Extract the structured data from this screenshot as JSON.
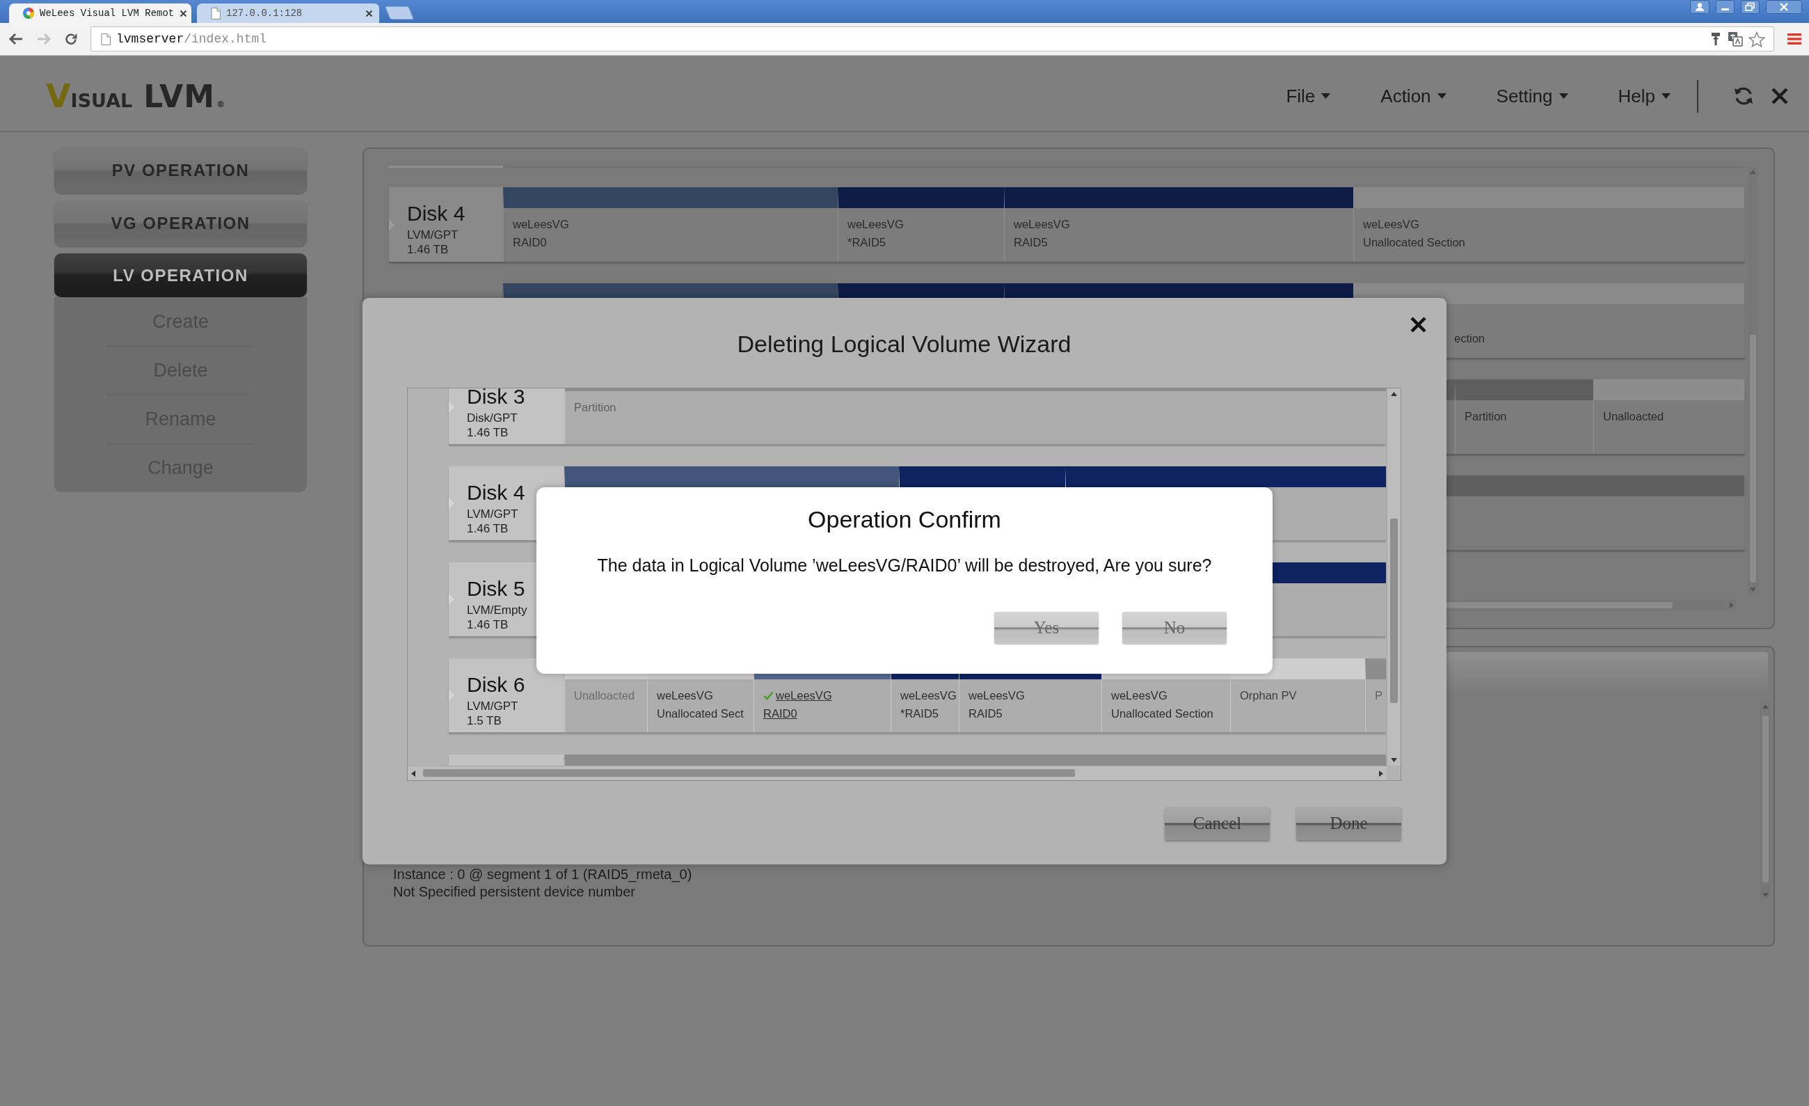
{
  "browser": {
    "tabs": [
      {
        "title": "WeLees Visual LVM Remot",
        "selected": true
      },
      {
        "title": "127.0.0.1:128",
        "selected": false
      }
    ],
    "address": {
      "host": "lvmserver",
      "path": "/index.html"
    }
  },
  "header": {
    "logo": {
      "initial": "V",
      "word": "ISUAL",
      "product": "LVM",
      "mark": "®"
    },
    "menus": [
      "File",
      "Action",
      "Setting",
      "Help"
    ]
  },
  "sidebar": {
    "sections": [
      {
        "label": "PV OPERATION",
        "selected": false
      },
      {
        "label": "VG OPERATION",
        "selected": false
      },
      {
        "label": "LV OPERATION",
        "selected": true,
        "items": [
          "Create",
          "Delete",
          "Rename",
          "Change"
        ]
      }
    ]
  },
  "disk_panel": {
    "rows": [
      {
        "name": "Disk 4",
        "type": "LVM/GPT",
        "size": "1.46 TB",
        "segments": [
          {
            "kind": "stripe",
            "title": "weLeesVG",
            "subtitle": "RAID0"
          },
          {
            "kind": "parity",
            "title": "weLeesVG",
            "subtitle": "*RAID5"
          },
          {
            "kind": "parity",
            "title": "weLeesVG",
            "subtitle": "RAID5"
          },
          {
            "kind": "vg-free",
            "title": "weLeesVG",
            "subtitle": "Unallocated Section"
          }
        ]
      },
      {
        "segments": [
          {
            "kind": "stripe"
          },
          {
            "kind": "parity"
          },
          {
            "kind": "parity"
          },
          {
            "kind": "vg-free",
            "subtitle": "ection"
          }
        ]
      },
      {
        "segments": [
          {
            "kind": "partition"
          },
          {
            "kind": "partition",
            "title": "Partition"
          },
          {
            "kind": "free",
            "title": "Unalloacted"
          }
        ]
      },
      {
        "segments": [
          {
            "kind": "partition"
          }
        ]
      }
    ]
  },
  "detail_panel": {
    "lines": [
      "Instance : 0 @ segment 1 of 1 (RAID5_rmeta_0)",
      "Not Specified persistent device number"
    ]
  },
  "wizard": {
    "title": "Deleting Logical Volume Wizard",
    "disks": [
      {
        "name": "Disk 3",
        "type": "Disk/GPT",
        "size": "1.46 TB",
        "segments": [
          {
            "kind": "partition",
            "title": "Partition",
            "selected": false
          }
        ]
      },
      {
        "name": "Disk 4",
        "type": "LVM/GPT",
        "size": "1.46 TB",
        "segments": [
          {
            "kind": "stripe",
            "selected": false
          },
          {
            "kind": "parity",
            "selected": false
          },
          {
            "kind": "parity",
            "selected": false
          }
        ]
      },
      {
        "name": "Disk 5",
        "type": "LVM/Empty",
        "size": "1.46 TB",
        "segments": [
          {
            "kind": "parity",
            "selected": false
          }
        ]
      },
      {
        "name": "Disk 6",
        "type": "LVM/GPT",
        "size": "1.5 TB",
        "segments": [
          {
            "kind": "free",
            "title": "Unalloacted",
            "selected": false
          },
          {
            "kind": "vg-free",
            "title": "weLeesVG",
            "subtitle": "Unallocated Sect",
            "selected": false
          },
          {
            "kind": "stripe",
            "title": "weLeesVG",
            "subtitle": "RAID0",
            "selected": true
          },
          {
            "kind": "parity",
            "title": "weLeesVG",
            "subtitle": "*RAID5",
            "selected": false
          },
          {
            "kind": "parity",
            "title": "weLeesVG",
            "subtitle": "RAID5",
            "selected": false
          },
          {
            "kind": "vg-free",
            "title": "weLeesVG",
            "subtitle": "Unallocated Section",
            "selected": false
          },
          {
            "kind": "orphan",
            "title": "Orphan PV",
            "selected": false
          },
          {
            "kind": "partition",
            "title": "P",
            "selected": false
          }
        ]
      },
      {
        "segments": [
          {
            "kind": "partition",
            "selected": false
          }
        ]
      }
    ],
    "buttons": [
      "Cancel",
      "Done"
    ]
  },
  "confirm": {
    "title": "Operation Confirm",
    "message": "The data in Logical Volume ’weLeesVG/RAID0’ will be destroyed, Are you sure?",
    "buttons": [
      "Yes",
      "No"
    ]
  }
}
